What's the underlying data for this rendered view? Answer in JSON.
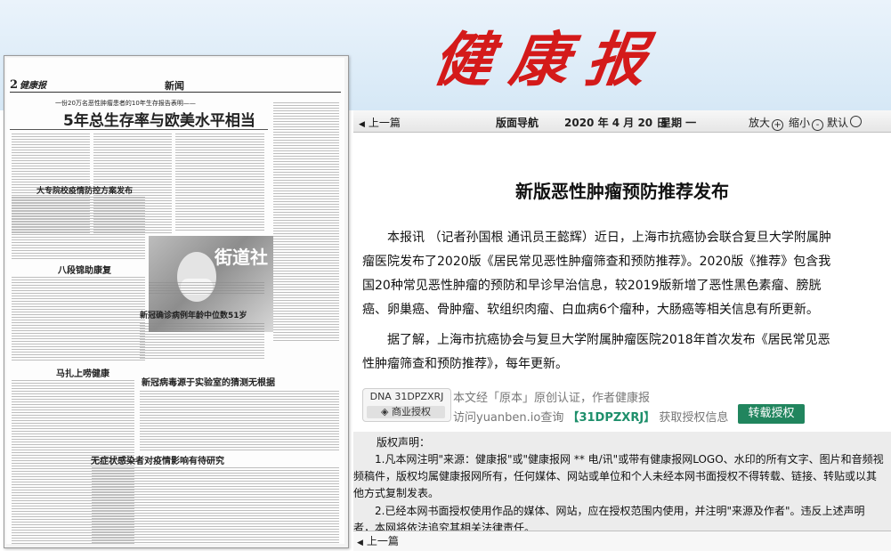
{
  "brand": {
    "logo_text": "健康报",
    "logo_color": "#d41a1a"
  },
  "newspaper_page": {
    "page_number": "2",
    "page_masthead": "健康报",
    "section": "新闻",
    "kicker": "一份20万名恶性肿瘤患者的10年生存报告表明——",
    "headline": "5年总生存率与欧美水平相当",
    "headlines": [
      "大专院校疫情防控方案发布",
      "八段锦助康复",
      "新冠确诊病例年龄中位数51岁",
      "马扎上唠健康",
      "新冠病毒源于实验室的猜测无根据",
      "无症状感染者对疫情影响有待研究"
    ],
    "photo_sign": "街道社"
  },
  "nav": {
    "prev_label": "上一篇",
    "guide_label": "版面导航",
    "date": "2020 年 4 月 20 日",
    "weekday": "星期 一",
    "zoom_in_label": "放大",
    "zoom_out_label": "缩小",
    "default_label": "默认"
  },
  "article": {
    "title": "新版恶性肿瘤预防推荐发布",
    "paragraphs": [
      "本报讯 （记者孙国根 通讯员王懿辉）近日，上海市抗癌协会联合复旦大学附属肿瘤医院发布了2020版《居民常见恶性肿瘤筛查和预防推荐》。2020版《推荐》包含我国20种常见恶性肿瘤的预防和早诊早治信息，较2019版新增了恶性黑色素瘤、膀胱癌、卵巢癌、骨肿瘤、软组织肉瘤、白血病6个瘤种，大肠癌等相关信息有所更新。",
      "据了解，上海市抗癌协会与复旦大学附属肿瘤医院2018年首次发布《居民常见恶性肿瘤筛查和预防推荐》，每年更新。"
    ]
  },
  "yuanben": {
    "dna_label": "DNA 31DPZXRJ",
    "biz_label": "商业授权",
    "line1": "本文经「原本」原创认证，作者健康报",
    "line2_prefix": "访问yuanben.io查询",
    "code": "【31DPZXRJ】",
    "line2_suffix": "获取授权信息",
    "button_label": "转载授权",
    "button_color": "#21855e"
  },
  "copyright": {
    "title": "版权声明：",
    "items": [
      "1.凡本网注明\"来源：健康报\"或\"健康报网 ** 电/讯\"或带有健康报网LOGO、水印的所有文字、图片和音频视频稿件，版权均属健康报网所有，任何媒体、网站或单位和个人未经本网书面授权不得转载、链接、转贴或以其他方式复制发表。",
      "2.已经本网书面授权使用作品的媒体、网站，应在授权范围内使用，并注明\"来源及作者\"。违反上述声明者，本网将依法追究其相关法律责任。"
    ]
  },
  "footer": {
    "prev_label": "上一篇"
  }
}
